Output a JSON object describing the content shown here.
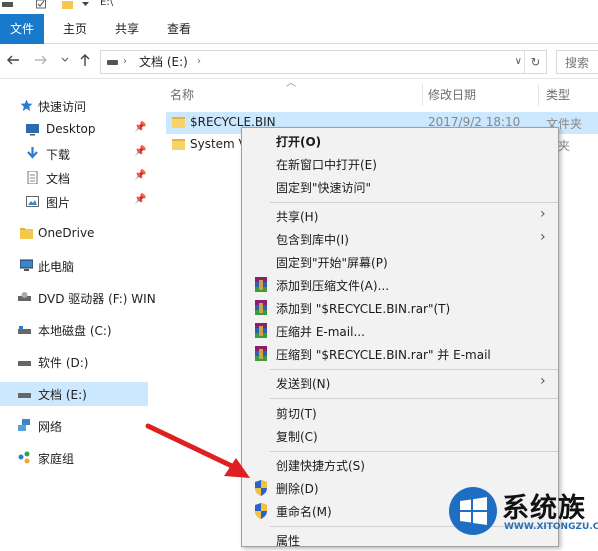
{
  "window": {
    "path": "E:\\"
  },
  "ribbon": {
    "tabs": [
      {
        "label": "文件"
      },
      {
        "label": "主页"
      },
      {
        "label": "共享"
      },
      {
        "label": "查看"
      }
    ]
  },
  "address": {
    "back_icon": "arrow-left-icon",
    "forward_icon": "arrow-right-icon",
    "up_icon": "arrow-up-icon",
    "segment": "文档 (E:)",
    "search_placeholder": "搜索"
  },
  "sidebar": {
    "items": [
      {
        "label": "快速访问",
        "icon": "star-icon"
      },
      {
        "label": "Desktop",
        "icon": "desktop-icon",
        "pinned": true
      },
      {
        "label": "下载",
        "icon": "download-icon",
        "pinned": true
      },
      {
        "label": "文档",
        "icon": "document-icon",
        "pinned": true
      },
      {
        "label": "图片",
        "icon": "picture-icon",
        "pinned": true
      },
      {
        "label": "OneDrive",
        "icon": "folder-icon"
      },
      {
        "label": "此电脑",
        "icon": "computer-icon"
      },
      {
        "label": "DVD 驱动器 (F:) WIN",
        "icon": "dvd-icon"
      },
      {
        "label": "本地磁盘 (C:)",
        "icon": "drive-icon"
      },
      {
        "label": "软件 (D:)",
        "icon": "drive-icon"
      },
      {
        "label": "文档 (E:)",
        "icon": "drive-icon",
        "selected": true
      },
      {
        "label": "网络",
        "icon": "network-icon"
      },
      {
        "label": "家庭组",
        "icon": "homegroup-icon"
      }
    ]
  },
  "columns": {
    "name": "名称",
    "date": "修改日期",
    "type": "类型"
  },
  "files": [
    {
      "name": "$RECYCLE.BIN",
      "date": "2017/9/2 18:10",
      "type": "文件夹",
      "selected": true
    },
    {
      "name": "System V",
      "date": "",
      "type": "件夹"
    }
  ],
  "context_menu": {
    "items": [
      {
        "label": "打开(O)",
        "bold": true
      },
      {
        "label": "在新窗口中打开(E)"
      },
      {
        "label": "固定到\"快速访问\""
      },
      {
        "label": "共享(H)",
        "submenu": true
      },
      {
        "label": "包含到库中(I)",
        "submenu": true
      },
      {
        "label": "固定到\"开始\"屏幕(P)"
      },
      {
        "label": "添加到压缩文件(A)...",
        "icon": "winrar-icon"
      },
      {
        "label": "添加到 \"$RECYCLE.BIN.rar\"(T)",
        "icon": "winrar-icon"
      },
      {
        "label": "压缩并 E-mail...",
        "icon": "winrar-icon"
      },
      {
        "label": "压缩到 \"$RECYCLE.BIN.rar\" 并 E-mail",
        "icon": "winrar-icon"
      },
      {
        "label": "发送到(N)",
        "submenu": true
      },
      {
        "label": "剪切(T)"
      },
      {
        "label": "复制(C)"
      },
      {
        "label": "创建快捷方式(S)"
      },
      {
        "label": "删除(D)",
        "icon": "shield-icon"
      },
      {
        "label": "重命名(M)",
        "icon": "shield-icon"
      },
      {
        "label": "属性"
      }
    ]
  },
  "watermark": {
    "brand": "系统族",
    "url": "WWW.XITONGZU.COM"
  },
  "colors": {
    "accent": "#1979ca",
    "selection": "#cce8ff",
    "arrow": "#e02020"
  }
}
